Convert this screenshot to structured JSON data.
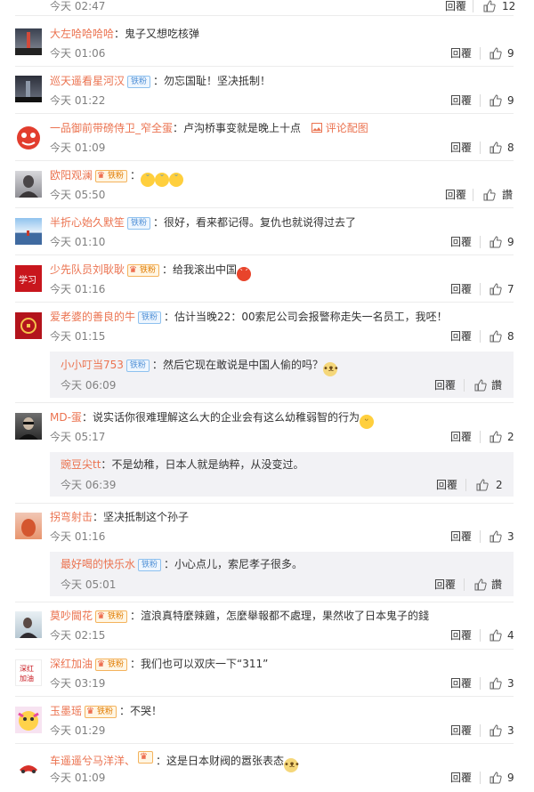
{
  "reply_label": "回覆",
  "like_icon": "thumbs-up-icon",
  "colors": {
    "username": "#eb7350",
    "badge_blue": "#4e8fd6",
    "badge_gold": "#e07b00"
  },
  "top": {
    "time": "今天 02:47",
    "likes": "12"
  },
  "comments": [
    {
      "user": "大左哈哈哈哈",
      "text": "鬼子又想吃核弹",
      "time": "今天 01:06",
      "likes": "9"
    },
    {
      "user": "巡天遥看星河汉",
      "badge": "铁粉",
      "text": "勿忘国耻！坚决抵制！",
      "time": "今天 01:22",
      "likes": "9"
    },
    {
      "user": "一品御前带磅侍卫_窄全蛋",
      "text": "卢沟桥事变就是晚上十点",
      "pic_link": "评论配图",
      "time": "今天 01:09",
      "likes": "8"
    },
    {
      "user": "欧阳观澜",
      "gold_badge": "铁粉",
      "time": "今天 05:50",
      "likes": "讚"
    },
    {
      "user": "半折心始久默笙",
      "badge": "铁粉",
      "text": "很好，看来都记得。复仇也就说得过去了",
      "time": "今天 01:10",
      "likes": "9"
    },
    {
      "user": "少先队员刘耿耿",
      "gold_badge": "铁粉",
      "text": "给我滚出中国",
      "time": "今天 01:16",
      "likes": "7"
    },
    {
      "user": "爱老婆的善良的牛",
      "badge": "铁粉",
      "text": "估计当晚22：00索尼公司会报警称走失一名员工，我呸！",
      "time": "今天 01:15",
      "likes": "8"
    },
    {
      "user": "小小叮当753",
      "badge": "铁粉",
      "text": "然后它现在敢说是中国人偷的吗？",
      "time": "今天 06:09",
      "likes": "讚"
    },
    {
      "user": "MD-蛋",
      "text": "说实话你很难理解这么大的企业会有这么幼稚弱智的行为",
      "time": "今天 05:17",
      "likes": "2"
    },
    {
      "user": "豌豆尖tt",
      "text": "不是幼稚，日本人就是纳粹，从没变过。",
      "time": "今天 06:39",
      "likes": "2"
    },
    {
      "user": "拐弯射击",
      "text": "坚决抵制这个孙子",
      "time": "今天 01:16",
      "likes": "3"
    },
    {
      "user": "最好喝的快乐水",
      "badge": "铁粉",
      "text": "小心点儿，索尼孝子很多。",
      "time": "今天 05:01",
      "likes": "讚"
    },
    {
      "user": "莫吵閫花",
      "gold_badge": "铁粉",
      "text": "渲浪真特麼辣雞，怎麼舉報都不處理，果然收了日本鬼子的錢",
      "time": "今天 02:15",
      "likes": "4"
    },
    {
      "user": "深红加油",
      "gold_badge": "铁粉",
      "text": "我们也可以双庆一下“311”",
      "time": "今天 03:19",
      "likes": "3"
    },
    {
      "user": "玉墨瑶",
      "gold_badge": "铁粉",
      "text": "不哭！",
      "time": "今天 01:29",
      "likes": "3"
    },
    {
      "user": "车遥遥兮马洋洋、",
      "text": "这是日本财阀的嚣张表态",
      "time": "今天 01:09",
      "likes": "9"
    }
  ]
}
